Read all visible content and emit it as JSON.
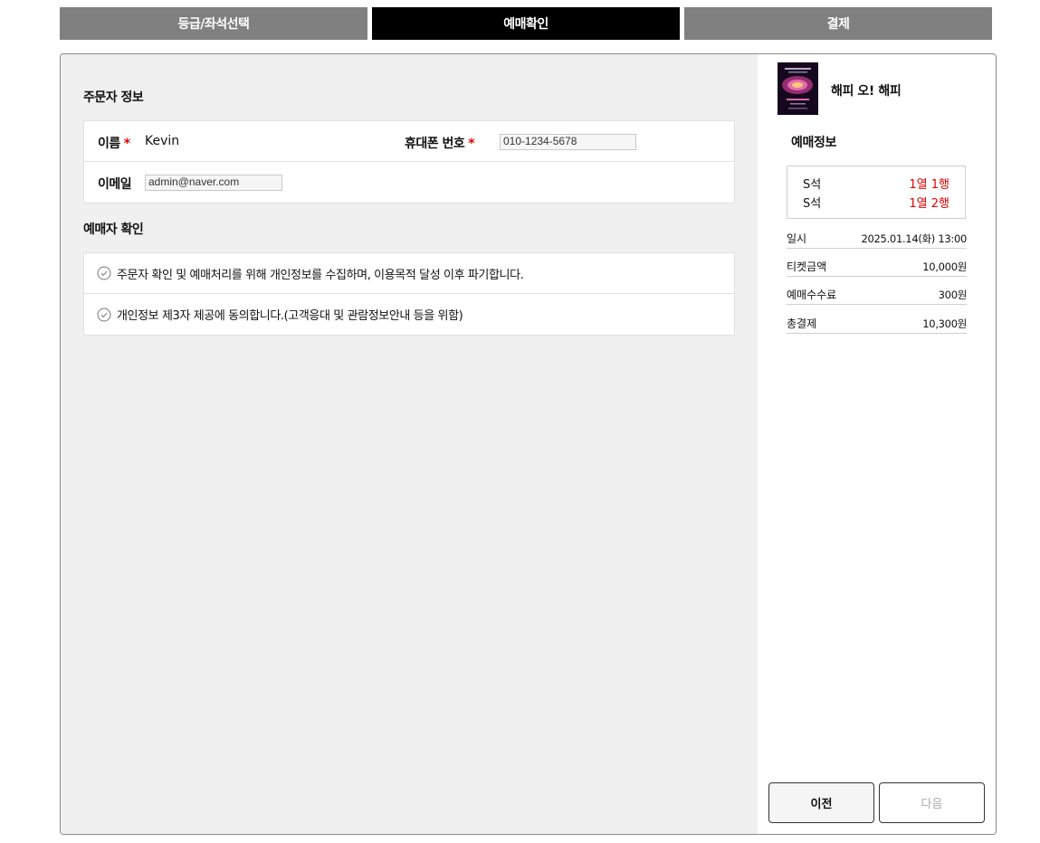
{
  "steps": [
    {
      "label": "등급/좌석선택",
      "active": false
    },
    {
      "label": "예매확인",
      "active": true
    },
    {
      "label": "결제",
      "active": false
    }
  ],
  "orderer": {
    "title": "주문자 정보",
    "name_label": "이름",
    "name_value": "Kevin",
    "phone_label": "휴대폰 번호",
    "phone_value": "010-1234-5678",
    "email_label": "이메일",
    "email_value": "admin@naver.com",
    "required_mark": "*"
  },
  "consent": {
    "title": "예매자 확인",
    "items": [
      "주문자 확인 및 예매처리를 위해 개인정보를 수집하며, 이용목적 달성 이후 파기합니다.",
      "개인정보 제3자 제공에 동의합니다.(고객응대 및 관람정보안내 등을 위함)"
    ]
  },
  "summary": {
    "show_title": "해피 오! 해피",
    "section_title": "예매정보",
    "seats": [
      {
        "grade": "S석",
        "position": "1열 1행"
      },
      {
        "grade": "S석",
        "position": "1열 2행"
      }
    ],
    "rows": [
      {
        "label": "일시",
        "value": "2025.01.14(화) 13:00"
      },
      {
        "label": "티켓금액",
        "value": "10,000원"
      },
      {
        "label": "예매수수료",
        "value": "300원"
      },
      {
        "label": "총결제",
        "value": "10,300원"
      }
    ]
  },
  "buttons": {
    "prev": "이전",
    "next": "다음"
  },
  "colors": {
    "active_step": "#000000",
    "inactive_step": "#808080",
    "required": "#e00000",
    "seat_position": "#e00000"
  }
}
